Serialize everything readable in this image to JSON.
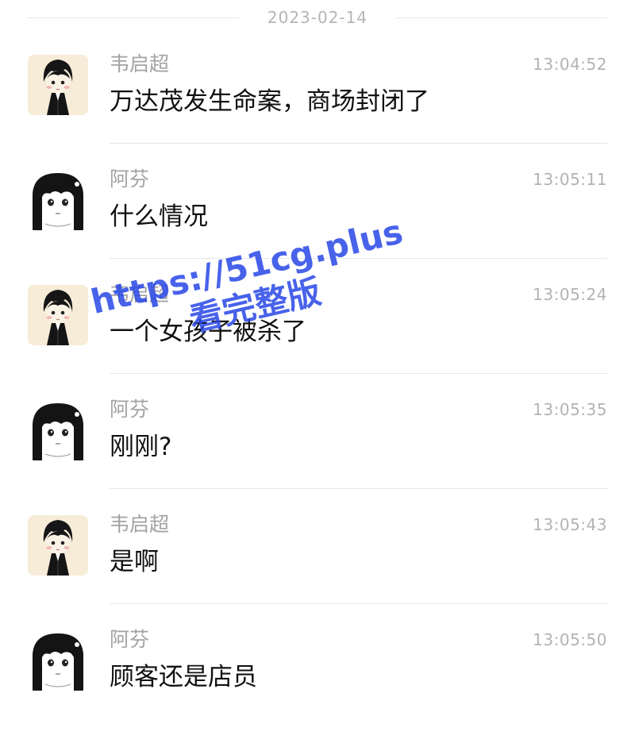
{
  "date": "2023-02-14",
  "colors": {
    "background": "#ffffff",
    "divider": "#e6e6e6",
    "meta_text": "#a3a3a3",
    "message_text": "#111111",
    "watermark": "#2846e6"
  },
  "messages": [
    {
      "sender": "韦启超",
      "time": "13:04:52",
      "text": "万达茂发生命案，商场封闭了",
      "avatar": "boy-avatar-icon"
    },
    {
      "sender": "阿芬",
      "time": "13:05:11",
      "text": "什么情况",
      "avatar": "girl-avatar-icon"
    },
    {
      "sender": "韦启超",
      "time": "13:05:24",
      "text": "一个女孩子被杀了",
      "avatar": "boy-avatar-icon"
    },
    {
      "sender": "阿芬",
      "time": "13:05:35",
      "text": "刚刚?",
      "avatar": "girl-avatar-icon"
    },
    {
      "sender": "韦启超",
      "time": "13:05:43",
      "text": "是啊",
      "avatar": "boy-avatar-icon"
    },
    {
      "sender": "阿芬",
      "time": "13:05:50",
      "text": "顾客还是店员",
      "avatar": "girl-avatar-icon"
    }
  ],
  "watermark": {
    "line1": "https://51cg.plus",
    "line2": "看完整版"
  }
}
